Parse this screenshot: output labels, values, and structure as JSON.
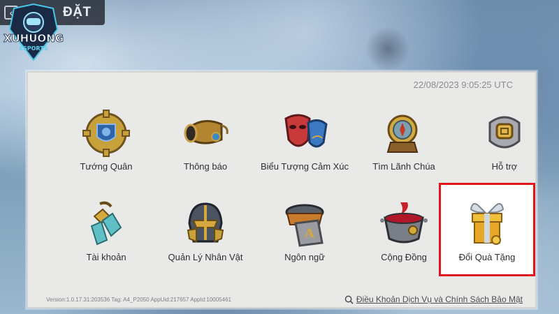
{
  "header": {
    "title": "ĐẶT",
    "back_icon": "back-arrow-icon"
  },
  "logo": {
    "text": "XUHUONG ESPORTS"
  },
  "panel": {
    "timestamp": "22/08/2023 9:05:25 UTC",
    "version": "Version:1.0.17.31:203536 Tag: A4_P2050 AppUid:217657 AppId:10005461",
    "terms_label": "Điều Khoản Dịch Vụ và Chính Sách Bảo Mật",
    "items": [
      {
        "label": "Tướng Quân",
        "icon": "gear-shield-icon"
      },
      {
        "label": "Thông báo",
        "icon": "horn-icon"
      },
      {
        "label": "Biểu Tượng Cảm Xúc",
        "icon": "masks-icon"
      },
      {
        "label": "Tìm Lãnh Chúa",
        "icon": "compass-icon"
      },
      {
        "label": "Hỗ trợ",
        "icon": "support-icon"
      },
      {
        "label": "Tài khoản",
        "icon": "chain-link-icon"
      },
      {
        "label": "Quản Lý Nhân Vật",
        "icon": "helmet-icon"
      },
      {
        "label": "Ngôn ngữ",
        "icon": "language-icon"
      },
      {
        "label": "Cộng Đồng",
        "icon": "cauldron-icon"
      },
      {
        "label": "Đổi Quà Tặng",
        "icon": "gift-icon"
      }
    ]
  },
  "colors": {
    "highlight": "#e2141b",
    "panel": "#e9e9e8",
    "gold": "#d9a531"
  }
}
